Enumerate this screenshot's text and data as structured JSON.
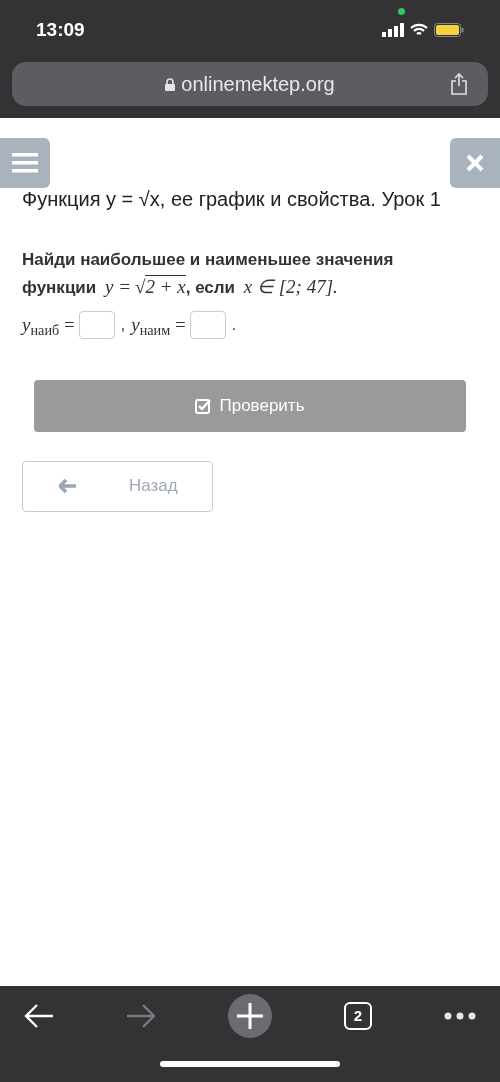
{
  "status_bar": {
    "time": "13:09"
  },
  "address_bar": {
    "url": "onlinemektep.org"
  },
  "lesson_title": "Функция y = √x, ее график и свойства. Урок 1",
  "question": [
    {
      "kind": "text",
      "text": "Найди наибольшее и наименьшее значения функции "
    },
    {
      "kind": "math",
      "text": "y ="
    },
    {
      "kind": "sqrt",
      "sign": "√",
      "text": "2 + x"
    },
    {
      "kind": "text",
      "text": ", если "
    },
    {
      "kind": "math",
      "text": "x ∈ [2; 47]."
    }
  ],
  "answers": [
    {
      "label": "*y*$_{наиб}$ =",
      "after": ","
    },
    {
      "label": "*y*$_{наим}$ =",
      "after": "."
    }
  ],
  "check_button": {
    "label": "Проверить",
    "disabled": true
  },
  "back_button": {
    "label": "Назад"
  },
  "toolbar": {
    "forward_disabled": true,
    "tabs_count": "2"
  }
}
